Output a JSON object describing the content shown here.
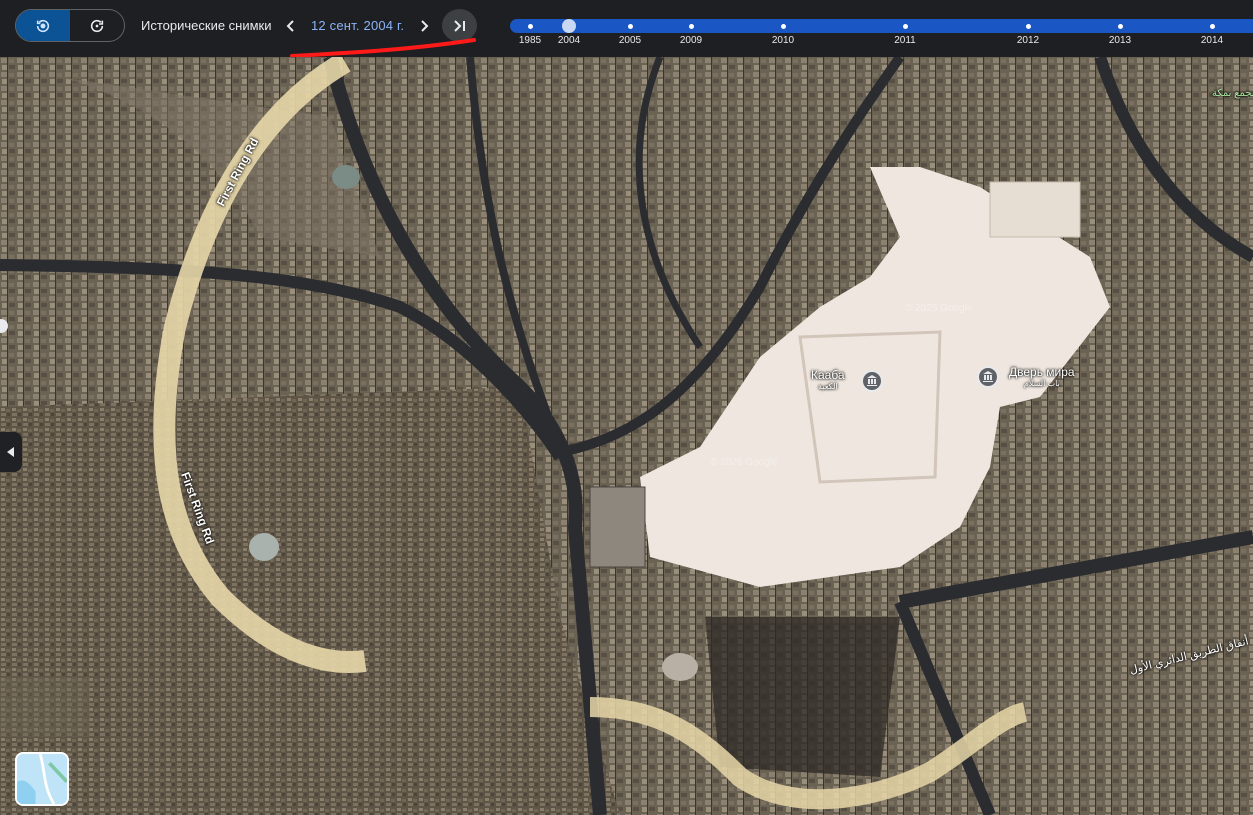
{
  "toolbar": {
    "mode_buttons": [
      {
        "icon": "historical-imagery-icon",
        "active": true
      },
      {
        "icon": "refresh-icon",
        "active": false
      }
    ],
    "title": "Исторические снимки",
    "date": "12 сент. 2004 г.",
    "prev_icon": "chevron-left-icon",
    "next_icon": "chevron-right-icon",
    "latest_icon": "skip-to-latest-icon"
  },
  "timeline": {
    "years": [
      "1985",
      "2004",
      "2005",
      "2009",
      "2010",
      "2011",
      "2012",
      "2013",
      "2014"
    ],
    "selected": "2004",
    "accent": "#1a56c4"
  },
  "map": {
    "places": [
      {
        "name": "Кааба",
        "name_ar": "الكعبة",
        "icon": "landmark-icon"
      },
      {
        "name": "Дверь мира",
        "name_ar": "باب السلام",
        "icon": "landmark-icon"
      }
    ],
    "roads": [
      "First Ring Rd",
      "First Ring Rd",
      "أنفاق الطريق الدائري الأول"
    ],
    "arabic_label": "مجمع بمكة",
    "watermarks": [
      "© 2025 Google",
      "© 2025 Google"
    ]
  },
  "annotation": {
    "color": "#ff1a1a"
  }
}
